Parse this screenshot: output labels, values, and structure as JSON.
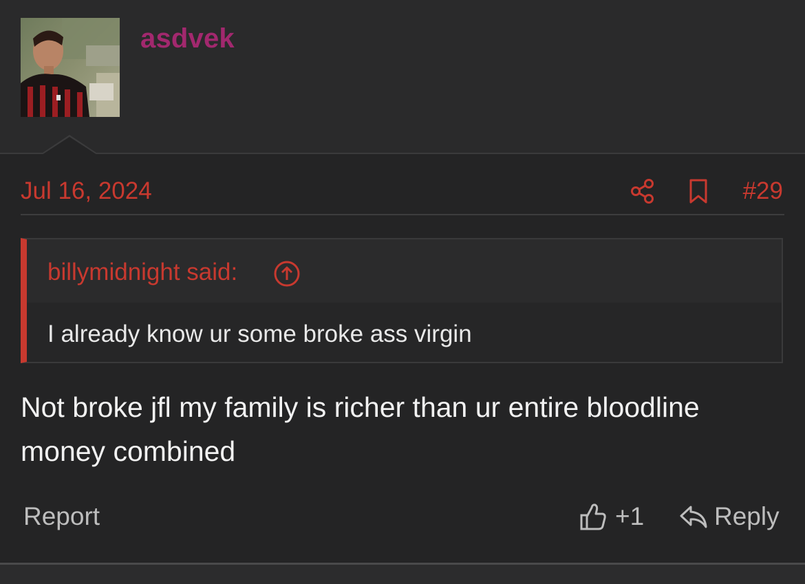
{
  "user": {
    "username": "asdvek"
  },
  "post": {
    "date": "Jul 16, 2024",
    "number": "#29",
    "quote": {
      "author_label": "billymidnight said:",
      "text": "I already know ur some broke ass virgin"
    },
    "message": "Not broke jfl my family is richer than ur entire bloodline money combined"
  },
  "actions": {
    "report_label": "Report",
    "like_count": "+1",
    "reply_label": "Reply"
  },
  "icons": {
    "share": "share-icon",
    "bookmark": "bookmark-icon",
    "quote_jump": "arrow-up-circle-icon",
    "like": "thumbs-up-icon",
    "reply": "reply-arrow-icon"
  },
  "colors": {
    "accent": "#c8392f",
    "username": "#a2286e",
    "background": "#242425"
  }
}
